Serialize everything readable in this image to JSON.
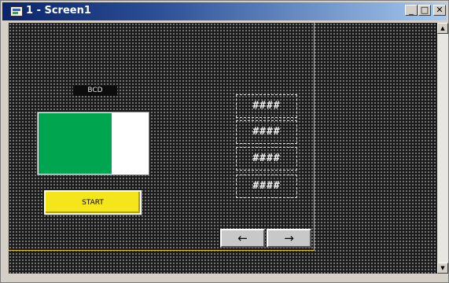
{
  "window": {
    "title": "1 - Screen1",
    "controls": {
      "minimize": "_",
      "maximize": "□",
      "close": "✕"
    }
  },
  "screen": {
    "bcd_label": "BCD",
    "level_bar": {
      "fill_fraction": 0.67,
      "fill_color": "#00a550",
      "empty_color": "#ffffff"
    },
    "start_button": {
      "label": "START",
      "color": "#f5e61c"
    },
    "numeric_displays": [
      "####",
      "####",
      "####",
      "####"
    ],
    "nav_buttons": {
      "prev": "←",
      "next": "→"
    },
    "background_color": "#1b1b1b",
    "guide_color": "#e0c020"
  },
  "scrollbar": {
    "up": "▲",
    "down": "▼"
  }
}
